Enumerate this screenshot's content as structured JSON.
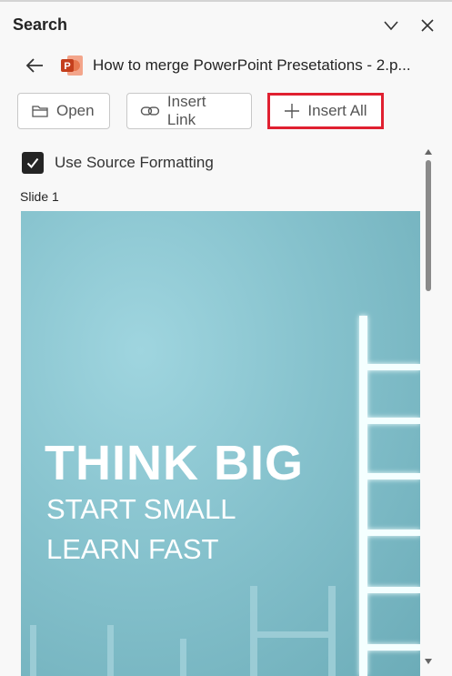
{
  "pane": {
    "title": "Search"
  },
  "file": {
    "name": "How to merge PowerPoint Presetations - 2.p..."
  },
  "actions": {
    "open_label": "Open",
    "insert_link_label": "Insert Link",
    "insert_all_label": "Insert All"
  },
  "options": {
    "use_source_formatting_label": "Use Source Formatting",
    "use_source_formatting_checked": true
  },
  "slides": [
    {
      "label": "Slide 1",
      "headline": "THINK BIG",
      "line1": "START SMALL",
      "line2": "LEARN FAST"
    }
  ],
  "colors": {
    "highlight": "#e02030",
    "ppt_brand": "#c43e1c",
    "slide_bg": "#86c2cd"
  },
  "icons": [
    "chevron-down-icon",
    "close-icon",
    "back-arrow-icon",
    "powerpoint-file-icon",
    "folder-icon",
    "link-icon",
    "plus-icon",
    "checkmark-icon"
  ]
}
